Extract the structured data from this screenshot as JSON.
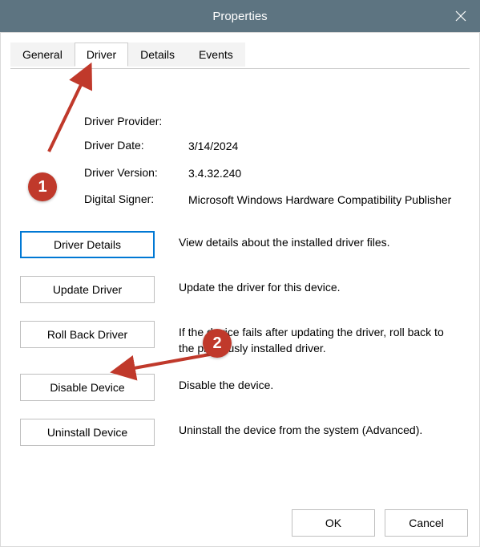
{
  "window": {
    "title": "Properties"
  },
  "tabs": {
    "general": "General",
    "driver": "Driver",
    "details": "Details",
    "events": "Events",
    "active": "driver"
  },
  "info": {
    "provider_label": "Driver Provider:",
    "provider_value": "",
    "date_label": "Driver Date:",
    "date_value": "3/14/2024",
    "version_label": "Driver Version:",
    "version_value": "3.4.32.240",
    "signer_label": "Digital Signer:",
    "signer_value": "Microsoft Windows Hardware Compatibility Publisher"
  },
  "actions": {
    "driver_details": {
      "label": "Driver Details",
      "desc": "View details about the installed driver files."
    },
    "update_driver": {
      "label": "Update Driver",
      "desc": "Update the driver for this device."
    },
    "roll_back": {
      "label": "Roll Back Driver",
      "desc": "If the device fails after updating the driver, roll back to the previously installed driver."
    },
    "disable": {
      "label": "Disable Device",
      "desc": "Disable the device."
    },
    "uninstall": {
      "label": "Uninstall Device",
      "desc": "Uninstall the device from the system (Advanced)."
    }
  },
  "footer": {
    "ok": "OK",
    "cancel": "Cancel"
  },
  "annotations": {
    "badge1": "1",
    "badge2": "2"
  }
}
